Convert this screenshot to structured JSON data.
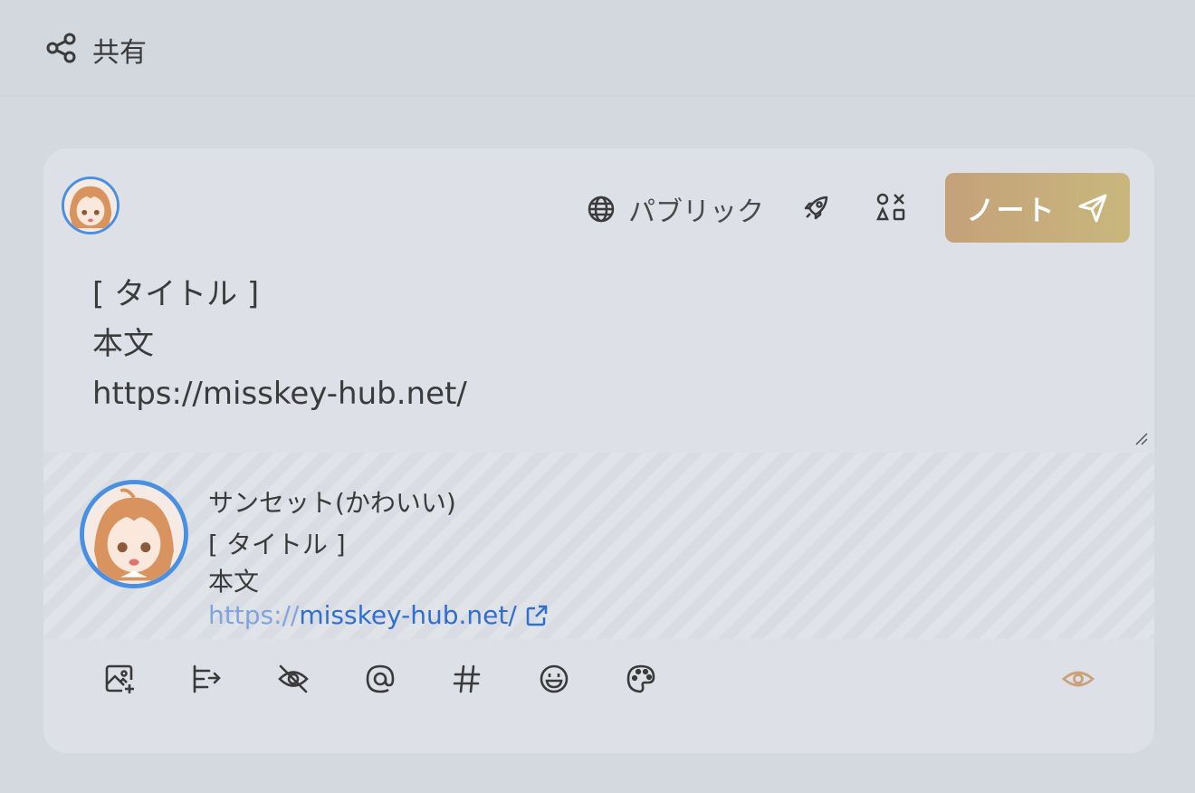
{
  "header": {
    "title": "共有",
    "icon": "share-icon"
  },
  "composer": {
    "visibility_label": "パブリック",
    "visibility_icon": "globe-icon",
    "note_button_label": "ノート",
    "text_lines": [
      "[ タイトル ]",
      "本文",
      "https://misskey-hub.net/"
    ],
    "preview": {
      "name": "サンセット(かわいい)",
      "line1": "[ タイトル ]",
      "line2": "本文",
      "link_scheme": "https://",
      "link_host": "misskey-hub.net/"
    },
    "toolbar_icons": [
      "image-add-icon",
      "poll-icon",
      "hide-icon",
      "mention-icon",
      "hashtag-icon",
      "emoji-icon",
      "palette-icon"
    ],
    "preview_toggle_icon": "eye-icon"
  },
  "colors": {
    "accent": "#4a90e2",
    "note_button_start": "#c5a17a",
    "note_button_end": "#c8b77d",
    "link": "#2f6fd1",
    "eye": "#c9a27b"
  }
}
